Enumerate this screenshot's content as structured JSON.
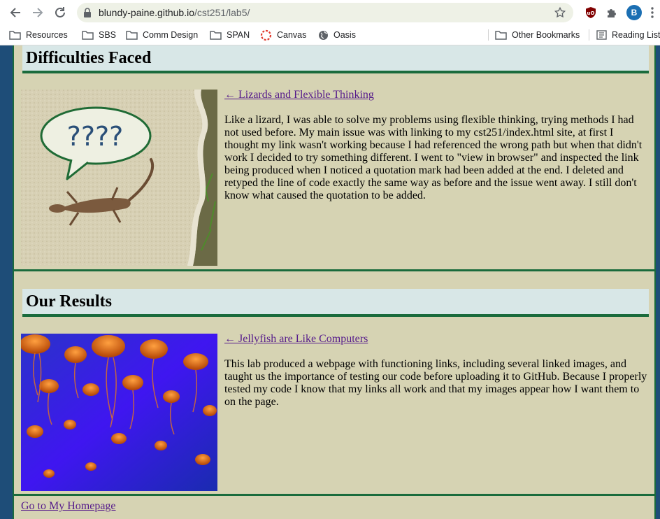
{
  "browser": {
    "url_host": "blundy-paine.github.io",
    "url_path": "/cst251/lab5/",
    "avatar_letter": "B",
    "bookmarks": [
      {
        "label": "Resources",
        "icon": "folder-icon"
      },
      {
        "label": "SBS",
        "icon": "folder-icon"
      },
      {
        "label": "Comm Design",
        "icon": "folder-icon"
      },
      {
        "label": "SPAN",
        "icon": "folder-icon"
      },
      {
        "label": "Canvas",
        "icon": "canvas-icon"
      },
      {
        "label": "Oasis",
        "icon": "globe-icon"
      }
    ],
    "other_bookmarks": "Other Bookmarks",
    "reading_list": "Reading List"
  },
  "page": {
    "sections": [
      {
        "heading": "Difficulties Faced",
        "link": "← Lizards and Flexible Thinking",
        "speech_bubble_text": "????",
        "text": "Like a lizard, I was able to solve my problems using flexible thinking, trying methods I had not used before. My main issue was with linking to my cst251/index.html site, at first I thought my link wasn't working because I had referenced the wrong path but when that didn't work I decided to try something different. I went to \"view in browser\" and inspected the link being produced when I noticed a quotation mark had been added at the end. I deleted and retyped the line of code exactly the same way as before and the issue went away. I still don't know what caused the quotation to be added."
      },
      {
        "heading": "Our Results",
        "link": "← Jellyfish are Like Computers",
        "text": "This lab produced a webpage with functioning links, including several linked images, and taught us the importance of testing our code before uploading it to GitHub. Because I properly tested my code I know that my links all work and that my images appear how I want them to on the page."
      }
    ],
    "footer_link": "Go to My Homepage"
  },
  "colors": {
    "page_background": "#d6d3b3",
    "outer_background": "#1e4d78",
    "heading_background": "#d8e7e7",
    "accent_green": "#1a6b3c",
    "visited_link": "#551a8b"
  }
}
